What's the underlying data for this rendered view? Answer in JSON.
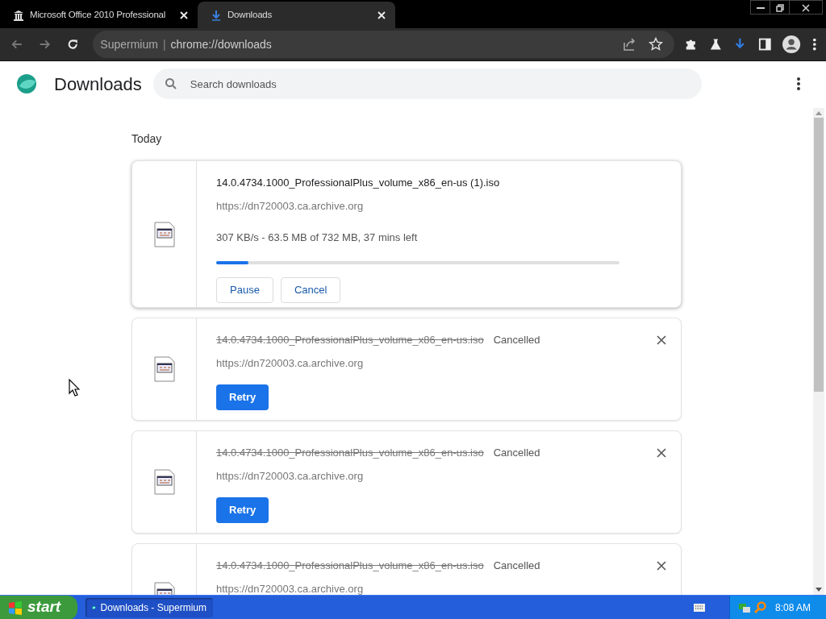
{
  "tabs": [
    {
      "title": "Microsoft Office 2010 Professional",
      "selected": false
    },
    {
      "title": "Downloads",
      "selected": true
    }
  ],
  "address_bar": {
    "origin": "Supermium",
    "separator": "|",
    "url": "chrome://downloads"
  },
  "page": {
    "title": "Downloads",
    "search": {
      "placeholder": "Search downloads"
    },
    "section": "Today",
    "downloads": [
      {
        "kind": "in_progress",
        "filename": "14.0.4734.1000_ProfessionalPlus_volume_x86_en-us (1).iso",
        "source": "https://dn720003.ca.archive.org",
        "progress_text": "307 KB/s - 63.5 MB of 732 MB, 37 mins left",
        "level": 0.08,
        "actions": [
          "Pause",
          "Cancel"
        ]
      },
      {
        "kind": "cancelled",
        "filename": "14.0.4734.1000_ProfessionalPlus_volume_x86_en-us.iso",
        "status": "Cancelled",
        "source": "https://dn720003.ca.archive.org",
        "actions": [
          "Retry"
        ]
      },
      {
        "kind": "cancelled",
        "filename": "14.0.4734.1000_ProfessionalPlus_volume_x86_en-us.iso",
        "status": "Cancelled",
        "source": "https://dn720003.ca.archive.org",
        "actions": [
          "Retry"
        ]
      },
      {
        "kind": "cancelled",
        "filename": "14.0.4734.1000_ProfessionalPlus_volume_x86_en-us.iso",
        "status": "Cancelled",
        "source": "https://dn720003.ca.archive.org"
      }
    ]
  },
  "taskbar": {
    "start": "start",
    "windows": [
      {
        "title": "Downloads - Supermium",
        "selected": true
      }
    ],
    "clock": "8:08 AM"
  }
}
